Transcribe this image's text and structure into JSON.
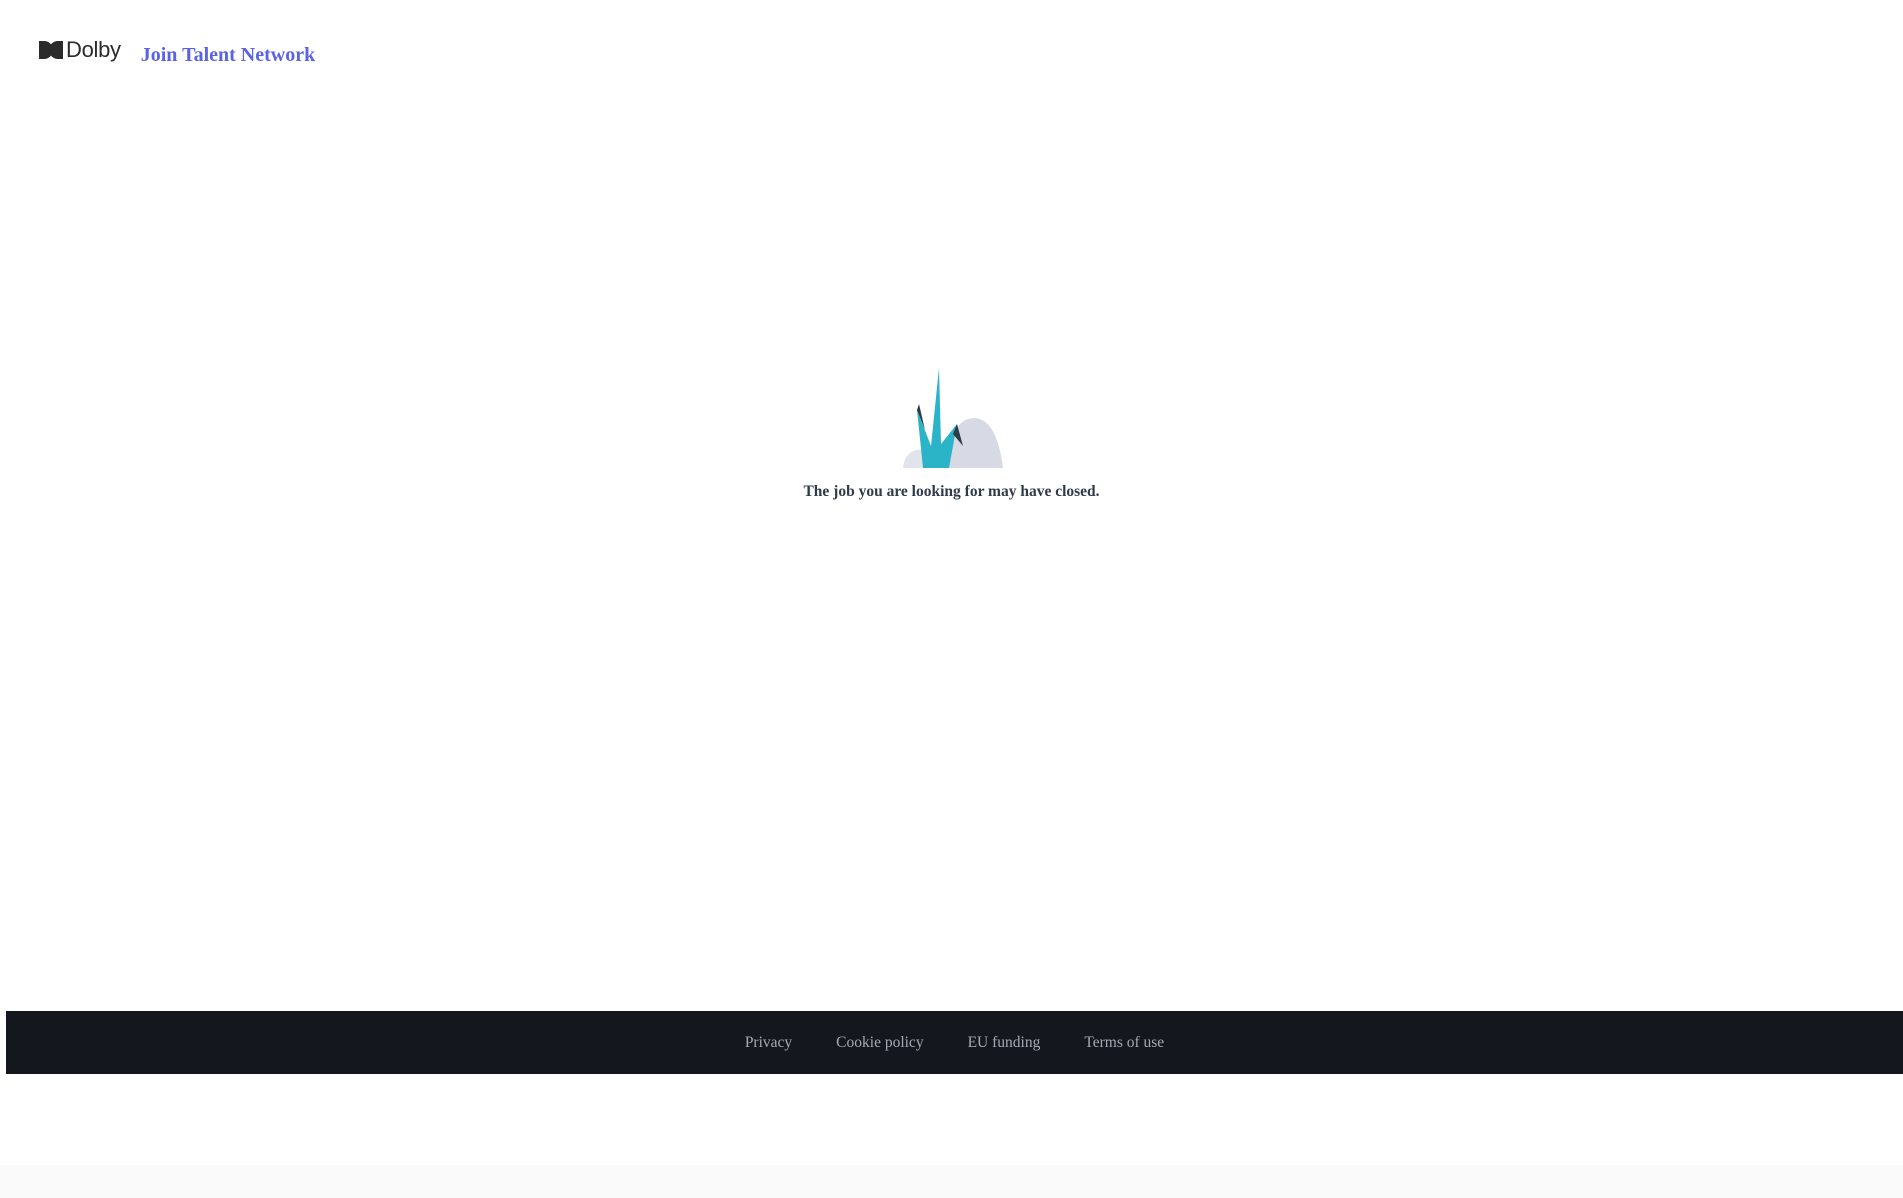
{
  "header": {
    "logo_text": "Dolby",
    "join_link": "Join Talent Network"
  },
  "main": {
    "closed_message": "The job you are looking for may have closed."
  },
  "footer": {
    "links": [
      "Privacy",
      "Cookie policy",
      "EU funding",
      "Terms of use"
    ]
  },
  "colors": {
    "brand_link": "#5b63e5",
    "footer_bg": "#14171d",
    "footer_text": "#a6abb3",
    "message_text": "#2f3b4a",
    "illustration_teal": "#2bb3c8",
    "illustration_grey": "#d7dae4"
  },
  "icons": {
    "logo": "dolby-logo-icon",
    "illustration": "plant-rock-illustration"
  }
}
